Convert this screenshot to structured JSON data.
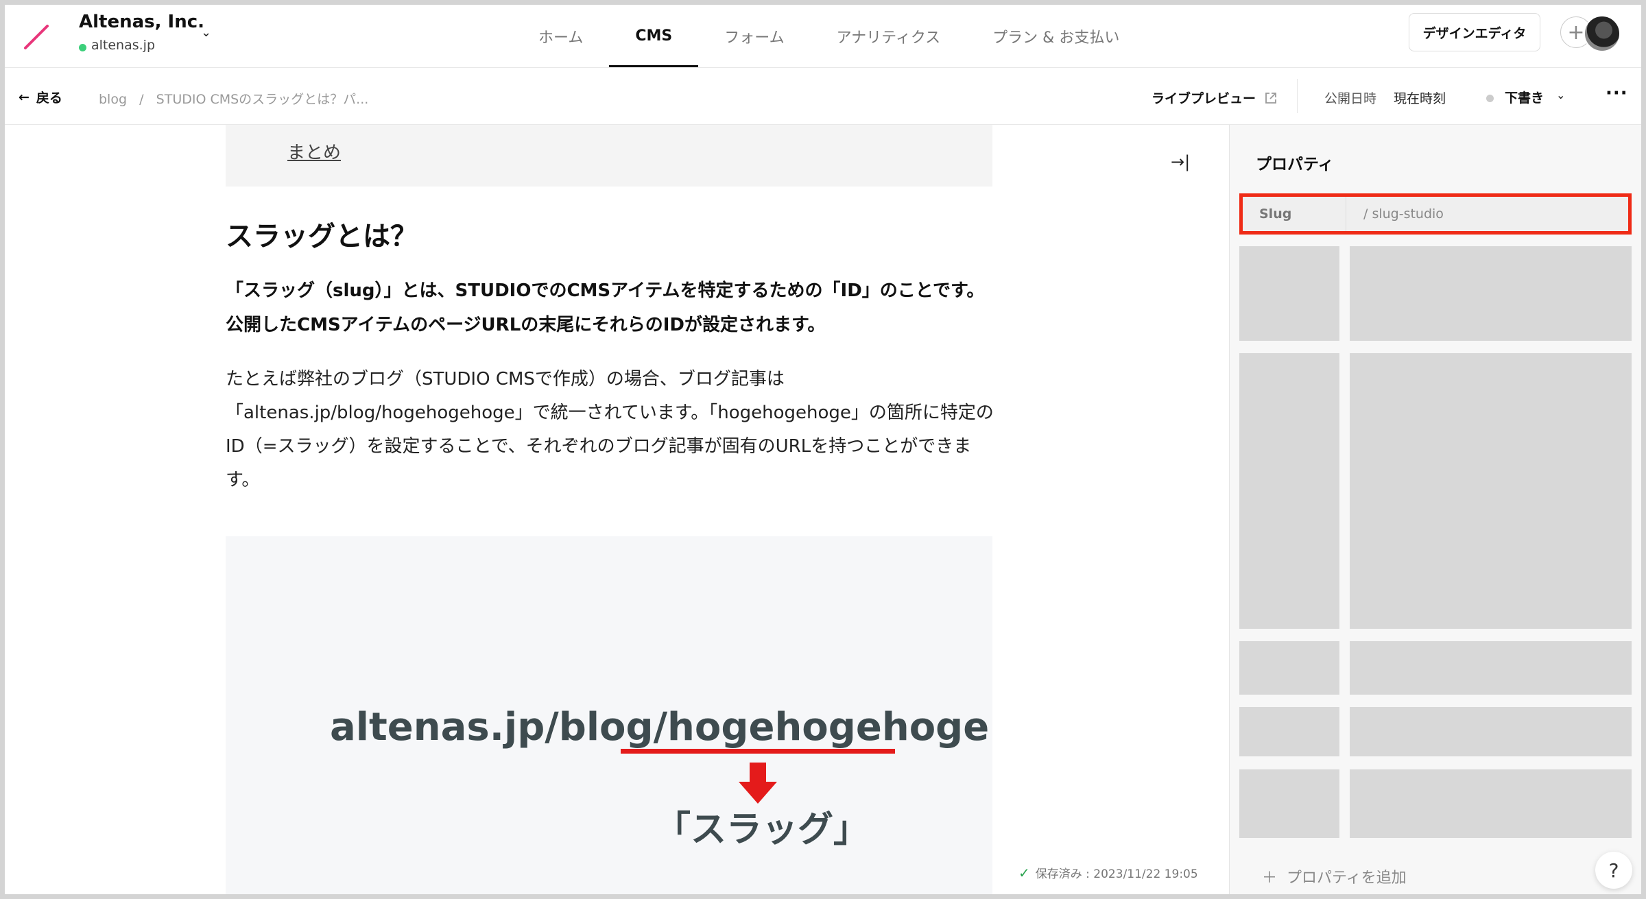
{
  "header": {
    "org_name": "Altenas, Inc.",
    "org_domain": "altenas.jp",
    "nav": [
      {
        "label": "ホーム"
      },
      {
        "label": "CMS"
      },
      {
        "label": "フォーム"
      },
      {
        "label": "アナリティクス"
      },
      {
        "label": "プラン & お支払い"
      }
    ],
    "design_editor_label": "デザインエディタ"
  },
  "subbar": {
    "back_label": "戻る",
    "breadcrumb": "blog   /   STUDIO CMSのスラッグとは？パ...",
    "live_preview_label": "ライブプレビュー",
    "publish_label": "公開日時",
    "publish_value": "現在時刻",
    "status_label": "下書き"
  },
  "editor": {
    "toc_link": "まとめ",
    "heading": "スラッグとは？",
    "lead": "「スラッグ（slug）」とは、STUDIOでのCMSアイテムを特定するための「ID」のことです。公開したCMSアイテムのページURLの末尾にそれらのIDが設定されます。",
    "body": "たとえば弊社のブログ（STUDIO CMSで作成）の場合、ブログ記事は「altenas.jp/blog/hogehogehoge」で統一されています。「hogehogehoge」の箇所に特定のID（=スラッグ）を設定することで、それぞれのブログ記事が固有のURLを持つことができます。",
    "image_url_prefix": "altenas.jp/blog/",
    "image_url_slug": "hogehogehoge",
    "image_caption": "「スラッグ」",
    "saved_status": "保存済み : 2023/11/22 19:05"
  },
  "panel": {
    "title": "プロパティ",
    "slug_key": "Slug",
    "slug_value": "/ slug-studio",
    "add_property_label": "＋  プロパティを追加",
    "help_label": "?"
  },
  "colors": {
    "highlight": "#ef2b16",
    "brand_slash": "#e8357a",
    "online": "#3ccf7a"
  }
}
